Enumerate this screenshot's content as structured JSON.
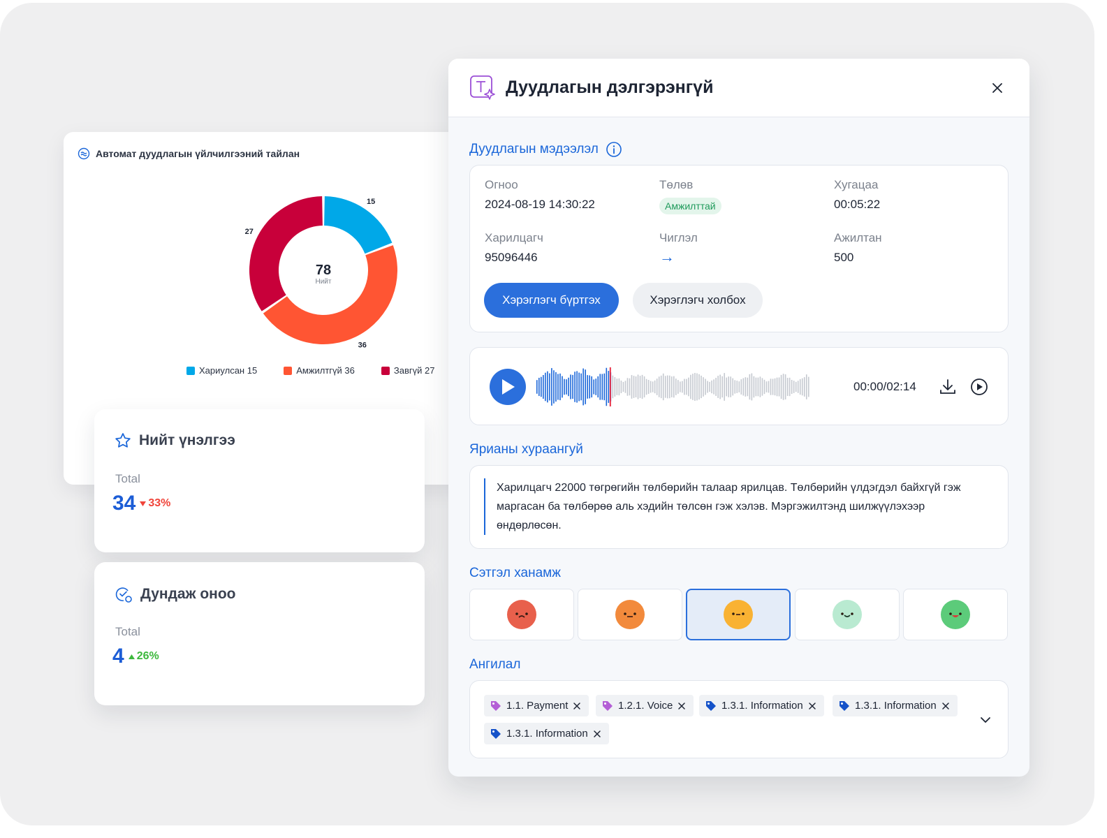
{
  "report": {
    "title": "Автомат дуудлагын үйлчилгээний тайлан",
    "total_value": "78",
    "total_label": "Нийт",
    "legend": [
      {
        "label": "Хариулсан 15",
        "color": "#00a8e8"
      },
      {
        "label": "Амжилтгүй 36",
        "color": "#ff5533"
      },
      {
        "label": "Завгүй 27",
        "color": "#c8003a"
      }
    ]
  },
  "chart_data": {
    "type": "pie",
    "categories": [
      "Хариулсан",
      "Амжилтгүй",
      "Завгүй"
    ],
    "values": [
      15,
      36,
      27
    ],
    "colors": [
      "#00a8e8",
      "#ff5533",
      "#c8003a"
    ],
    "data_labels": [
      "15",
      "36",
      "27"
    ],
    "center_value": 78,
    "center_label": "Нийт"
  },
  "stats": {
    "rating": {
      "title": "Нийт үнэлгээ",
      "label": "Total",
      "value": "34",
      "change": "33%",
      "trend": "down",
      "color": "#f0443a"
    },
    "score": {
      "title": "Дундаж оноо",
      "label": "Total",
      "value": "4",
      "change": "26%",
      "trend": "up",
      "color": "#3cb83c"
    }
  },
  "modal": {
    "title": "Дуудлагын дэлгэрэнгүй",
    "info_title": "Дуудлагын мэдээлэл",
    "fields": {
      "date": {
        "label": "Огноо",
        "value": "2024-08-19 14:30:22"
      },
      "status": {
        "label": "Төлөв",
        "value": "Амжилттай"
      },
      "duration": {
        "label": "Хугацаа",
        "value": "00:05:22"
      },
      "customer": {
        "label": "Харилцагч",
        "value": "95096446"
      },
      "direction": {
        "label": "Чиглэл",
        "value": "→"
      },
      "employee": {
        "label": "Ажилтан",
        "value": "500"
      }
    },
    "register_button": "Хэрэглэгч бүртгэх",
    "link_button": "Хэрэглэгч холбох",
    "audio": {
      "time": "00:00/02:14",
      "progress": 0.27
    },
    "summary_title": "Ярианы хураангуй",
    "summary_text": "Харилцагч 22000 төгрөгийн төлбөрийн талаар ярилцав. Төлбөрийн үлдэгдэл байхгүй гэж маргасан ба төлбөрөө аль хэдийн төлсөн гэж хэлэв. Мэргэжилтэнд шилжүүлэхээр өндөрлөсөн.",
    "mood_title": "Сэтгэл ханамж",
    "moods": [
      {
        "name": "very-unhappy",
        "color": "#e8604c",
        "selected": false
      },
      {
        "name": "unhappy",
        "color": "#f28a3c",
        "selected": false
      },
      {
        "name": "neutral",
        "color": "#f9b233",
        "selected": true
      },
      {
        "name": "happy",
        "color": "#b9ead1",
        "selected": false
      },
      {
        "name": "very-happy",
        "color": "#5ccb7a",
        "selected": false
      }
    ],
    "category_title": "Ангилал",
    "tags": [
      {
        "label": "1.1. Payment",
        "color": "#b45fd6"
      },
      {
        "label": "1.2.1. Voice",
        "color": "#b45fd6"
      },
      {
        "label": "1.3.1. Information",
        "color": "#1552c9"
      },
      {
        "label": "1.3.1. Information",
        "color": "#1552c9"
      },
      {
        "label": "1.3.1. Information",
        "color": "#1552c9"
      }
    ]
  }
}
